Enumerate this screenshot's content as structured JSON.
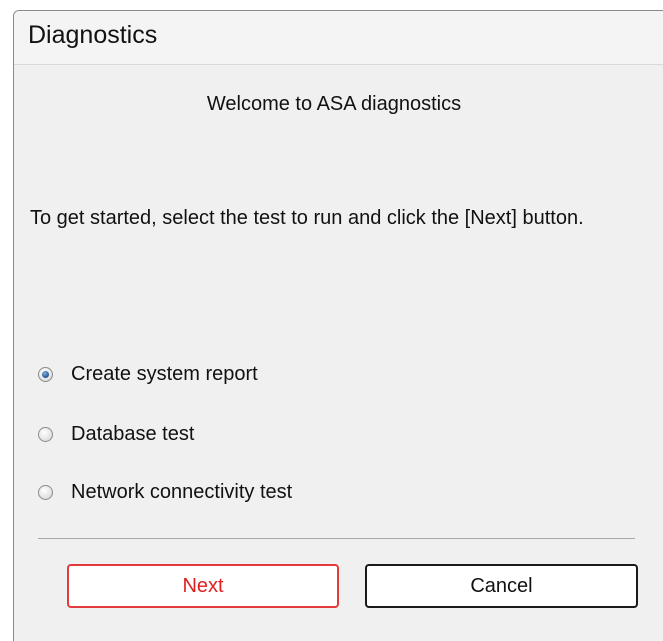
{
  "window": {
    "title": "Diagnostics"
  },
  "content": {
    "welcome": "Welcome to ASA diagnostics",
    "instructions": "To get started, select the test to run and click the [Next] button."
  },
  "tests": [
    {
      "label": "Create system report",
      "selected": true
    },
    {
      "label": "Database test",
      "selected": false
    },
    {
      "label": "Network connectivity test",
      "selected": false
    }
  ],
  "buttons": {
    "next_label": "Next",
    "cancel_label": "Cancel"
  },
  "colors": {
    "next_accent": "#e02020",
    "window_bg": "#f0f0f0"
  }
}
